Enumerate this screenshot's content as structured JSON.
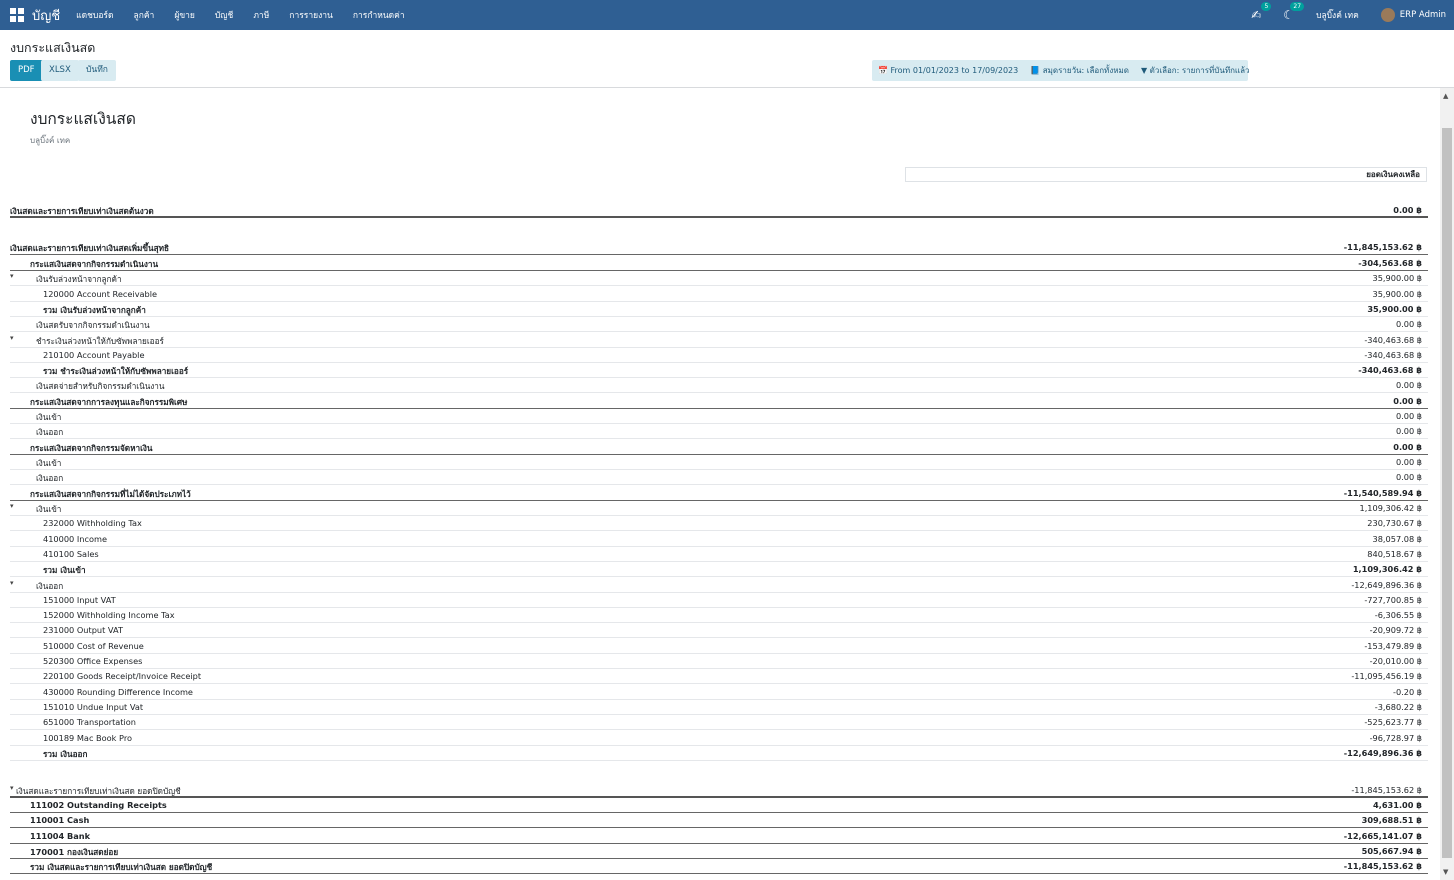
{
  "navbar": {
    "app_name": "บัญชี",
    "menu": [
      "แดชบอร์ด",
      "ลูกค้า",
      "ผู้ขาย",
      "บัญชี",
      "ภาษี",
      "การรายงาน",
      "การกำหนดค่า"
    ],
    "messages_count": "5",
    "activities_count": "27",
    "company": "บลูบิ๊งค์ เทค",
    "user": "ERP Admin"
  },
  "control_panel": {
    "page_title": "งบกระแสเงินสด",
    "buttons": {
      "pdf": "PDF",
      "xlsx": "XLSX",
      "save": "บันทึก"
    },
    "filters": {
      "date": "From 01/01/2023 to 17/09/2023",
      "journals": "สมุดรายวัน: เลือกทั้งหมด",
      "options": "ตัวเลือก: รายการที่บันทึกแล้ว"
    }
  },
  "report": {
    "title": "งบกระแสเงินสด",
    "company": "บลูบิ๊งค์ เทค",
    "column_header": "ยอดเงินคงเหลือ",
    "rows": [
      {
        "label": "เงินสดและรายการเทียบเท่าเงินสดต้นงวด",
        "amount": "0.00 ฿",
        "level": 0,
        "bold": true,
        "border": "line"
      },
      {
        "label": "",
        "amount": "",
        "level": 0,
        "bold": false,
        "border": "none"
      },
      {
        "label": "เงินสดและรายการเทียบเท่าเงินสดเพิ่มขึ้นสุทธิ",
        "amount": "-11,845,153.62 ฿",
        "level": 0,
        "bold": true,
        "border": "mid"
      },
      {
        "label": "กระแสเงินสดจากกิจกรรมดำเนินงาน",
        "amount": "-304,563.68 ฿",
        "level": 1,
        "bold": true,
        "border": "mid"
      },
      {
        "label": "เงินรับล่วงหน้าจากลูกค้า",
        "amount": "35,900.00 ฿",
        "level": 2,
        "bold": false,
        "caret": true
      },
      {
        "label": "120000 Account Receivable",
        "amount": "35,900.00 ฿",
        "level": 3,
        "bold": false
      },
      {
        "label": "รวม เงินรับล่วงหน้าจากลูกค้า",
        "amount": "35,900.00 ฿",
        "level": 3,
        "bold": true
      },
      {
        "label": "เงินสดรับจากกิจกรรมดำเนินงาน",
        "amount": "0.00 ฿",
        "level": 2,
        "bold": false
      },
      {
        "label": "ชำระเงินล่วงหน้าให้กับซัพพลายเออร์",
        "amount": "-340,463.68 ฿",
        "level": 2,
        "bold": false,
        "caret": true
      },
      {
        "label": "210100 Account Payable",
        "amount": "-340,463.68 ฿",
        "level": 3,
        "bold": false
      },
      {
        "label": "รวม ชำระเงินล่วงหน้าให้กับซัพพลายเออร์",
        "amount": "-340,463.68 ฿",
        "level": 3,
        "bold": true
      },
      {
        "label": "เงินสดจ่ายสำหรับกิจกรรมดำเนินงาน",
        "amount": "0.00 ฿",
        "level": 2,
        "bold": false
      },
      {
        "label": "กระแสเงินสดจากการลงทุนและกิจกรรมพิเศษ",
        "amount": "0.00 ฿",
        "level": 1,
        "bold": true,
        "border": "mid"
      },
      {
        "label": "เงินเข้า",
        "amount": "0.00 ฿",
        "level": 2,
        "bold": false
      },
      {
        "label": "เงินออก",
        "amount": "0.00 ฿",
        "level": 2,
        "bold": false
      },
      {
        "label": "กระแสเงินสดจากกิจกรรมจัดหาเงิน",
        "amount": "0.00 ฿",
        "level": 1,
        "bold": true,
        "border": "mid"
      },
      {
        "label": "เงินเข้า",
        "amount": "0.00 ฿",
        "level": 2,
        "bold": false
      },
      {
        "label": "เงินออก",
        "amount": "0.00 ฿",
        "level": 2,
        "bold": false
      },
      {
        "label": "กระแสเงินสดจากกิจกรรมที่ไม่ได้จัดประเภทไว้",
        "amount": "-11,540,589.94 ฿",
        "level": 1,
        "bold": true,
        "border": "mid"
      },
      {
        "label": "เงินเข้า",
        "amount": "1,109,306.42 ฿",
        "level": 2,
        "bold": false,
        "caret": true
      },
      {
        "label": "232000 Withholding Tax",
        "amount": "230,730.67 ฿",
        "level": 3,
        "bold": false
      },
      {
        "label": "410000 Income",
        "amount": "38,057.08 ฿",
        "level": 3,
        "bold": false
      },
      {
        "label": "410100 Sales",
        "amount": "840,518.67 ฿",
        "level": 3,
        "bold": false
      },
      {
        "label": "รวม เงินเข้า",
        "amount": "1,109,306.42 ฿",
        "level": 3,
        "bold": true
      },
      {
        "label": "เงินออก",
        "amount": "-12,649,896.36 ฿",
        "level": 2,
        "bold": false,
        "caret": true
      },
      {
        "label": "151000 Input VAT",
        "amount": "-727,700.85 ฿",
        "level": 3,
        "bold": false
      },
      {
        "label": "152000 Withholding Income Tax",
        "amount": "-6,306.55 ฿",
        "level": 3,
        "bold": false
      },
      {
        "label": "231000 Output VAT",
        "amount": "-20,909.72 ฿",
        "level": 3,
        "bold": false
      },
      {
        "label": "510000 Cost of Revenue",
        "amount": "-153,479.89 ฿",
        "level": 3,
        "bold": false
      },
      {
        "label": "520300 Office Expenses",
        "amount": "-20,010.00 ฿",
        "level": 3,
        "bold": false
      },
      {
        "label": "220100 Goods Receipt/Invoice Receipt",
        "amount": "-11,095,456.19 ฿",
        "level": 3,
        "bold": false
      },
      {
        "label": "430000 Rounding Difference Income",
        "amount": "-0.20 ฿",
        "level": 3,
        "bold": false
      },
      {
        "label": "151010 Undue Input Vat",
        "amount": "-3,680.22 ฿",
        "level": 3,
        "bold": false
      },
      {
        "label": "651000 Transportation",
        "amount": "-525,623.77 ฿",
        "level": 3,
        "bold": false
      },
      {
        "label": "100189 Mac Book Pro",
        "amount": "-96,728.97 ฿",
        "level": 3,
        "bold": false
      },
      {
        "label": "รวม เงินออก",
        "amount": "-12,649,896.36 ฿",
        "level": 3,
        "bold": true
      },
      {
        "label": "",
        "amount": "",
        "level": 0,
        "bold": false,
        "border": "none"
      },
      {
        "label": "เงินสดและรายการเทียบเท่าเงินสด ยอดปิดบัญชี",
        "amount": "-11,845,153.62 ฿",
        "level": 0,
        "bold": false,
        "border": "line",
        "caret": true
      },
      {
        "label": "111002 Outstanding Receipts",
        "amount": "4,631.00 ฿",
        "level": 1,
        "bold": true,
        "border": "mid"
      },
      {
        "label": "110001 Cash",
        "amount": "309,688.51 ฿",
        "level": 1,
        "bold": true,
        "border": "mid"
      },
      {
        "label": "111004 Bank",
        "amount": "-12,665,141.07 ฿",
        "level": 1,
        "bold": true,
        "border": "mid"
      },
      {
        "label": "170001 กองเงินสดย่อย",
        "amount": "505,667.94 ฿",
        "level": 1,
        "bold": true,
        "border": "mid"
      },
      {
        "label": "รวม เงินสดและรายการเทียบเท่าเงินสด ยอดปิดบัญชี",
        "amount": "-11,845,153.62 ฿",
        "level": 1,
        "bold": true,
        "border": "mid"
      }
    ]
  }
}
